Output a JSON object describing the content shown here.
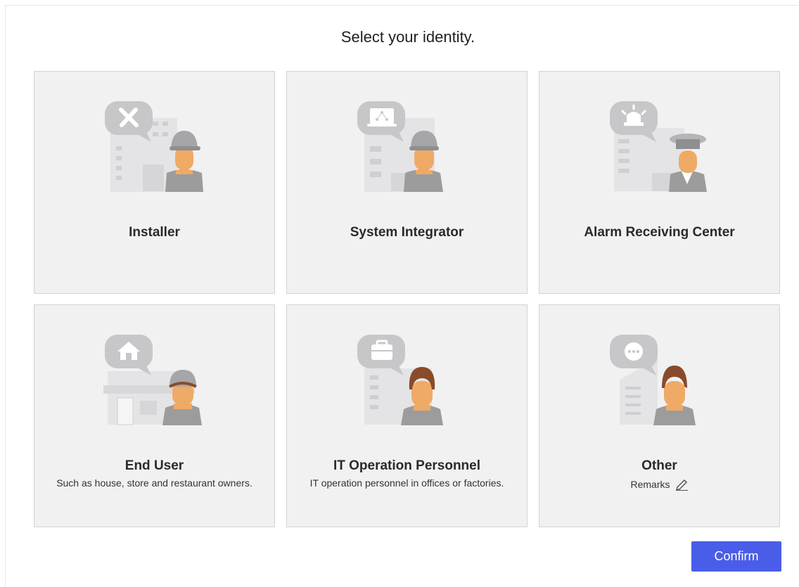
{
  "title": "Select your identity.",
  "cards": [
    {
      "label": "Installer",
      "description": "",
      "badge_icon": "tools-icon"
    },
    {
      "label": "System Integrator",
      "description": "",
      "badge_icon": "laptop-network-icon"
    },
    {
      "label": "Alarm Receiving Center",
      "description": "",
      "badge_icon": "siren-icon"
    },
    {
      "label": "End User",
      "description": "Such as house, store and restaurant owners.",
      "badge_icon": "home-icon"
    },
    {
      "label": "IT Operation Personnel",
      "description": "IT operation personnel in offices or factories.",
      "badge_icon": "briefcase-icon"
    },
    {
      "label": "Other",
      "description": "",
      "badge_icon": "chat-dots-icon",
      "remarks_label": "Remarks"
    }
  ],
  "confirm_label": "Confirm",
  "colors": {
    "card_bg": "#f1f1f2",
    "card_border": "#d3d3d5",
    "confirm_bg": "#4a5de8",
    "skin": "#efaa66",
    "hair": "#8a4b2a",
    "gray": "#9c9c9c"
  }
}
